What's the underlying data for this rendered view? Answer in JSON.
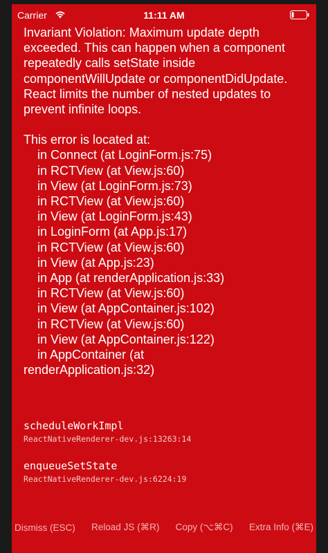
{
  "status_bar": {
    "carrier": "Carrier",
    "time": "11:11 AM",
    "icons": [
      "wifi-icon",
      "battery-icon"
    ]
  },
  "error": {
    "message": "Invariant Violation: Maximum update depth exceeded. This can happen when a component repeatedly calls setState inside componentWillUpdate or componentDidUpdate. React limits the number of nested updates to prevent infinite loops.",
    "location_heading": "This error is located at:",
    "component_stack": [
      "in Connect (at LoginForm.js:75)",
      "in RCTView (at View.js:60)",
      "in View (at LoginForm.js:73)",
      "in RCTView (at View.js:60)",
      "in View (at LoginForm.js:43)",
      "in LoginForm (at App.js:17)",
      "in RCTView (at View.js:60)",
      "in View (at App.js:23)",
      "in App (at renderApplication.js:33)",
      "in RCTView (at View.js:60)",
      "in View (at AppContainer.js:102)",
      "in RCTView (at View.js:60)",
      "in View (at AppContainer.js:122)",
      "in AppContainer (at",
      "renderApplication.js:32)"
    ]
  },
  "stack": [
    {
      "method": "scheduleWorkImpl",
      "file": "ReactNativeRenderer-dev.js:13263:14"
    },
    {
      "method": "enqueueSetState",
      "file": "ReactNativeRenderer-dev.js:6224:19"
    }
  ],
  "toolbar": {
    "dismiss": "Dismiss (ESC)",
    "reload": "Reload JS (⌘R)",
    "copy": "Copy (⌥⌘C)",
    "extra_info": "Extra Info (⌘E)"
  },
  "colors": {
    "background": "#cc0c12",
    "text": "#ffffff",
    "toolbar_text": "#f2b6b6",
    "file_text": "#f3c9c9",
    "frame": "#1a1a1a"
  }
}
